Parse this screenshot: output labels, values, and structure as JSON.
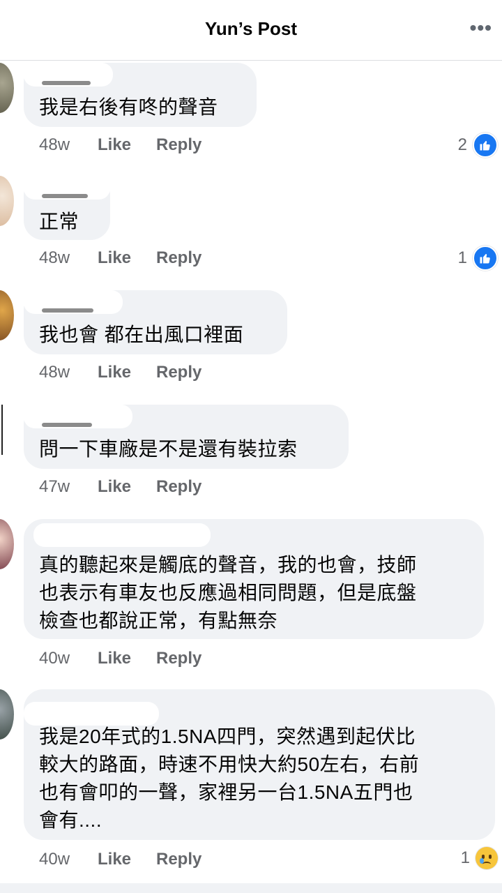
{
  "header": {
    "title": "Yun’s Post",
    "more_icon": "more-dots-icon"
  },
  "labels": {
    "like": "Like",
    "reply": "Reply"
  },
  "comments": [
    {
      "text": "我是右後有咚的聲音",
      "time": "48w",
      "reaction_count": "2",
      "reaction_type": "like"
    },
    {
      "text": "正常",
      "time": "48w",
      "reaction_count": "1",
      "reaction_type": "like"
    },
    {
      "text": "我也會 都在出風口裡面",
      "time": "48w",
      "reaction_count": "",
      "reaction_type": ""
    },
    {
      "text": "問一下車廠是不是還有裝拉索",
      "time": "47w",
      "reaction_count": "",
      "reaction_type": ""
    },
    {
      "text": "真的聽起來是觸底的聲音，我的也會，技師\n也表示有車友也反應過相同問題，但是底盤\n檢查也都說正常，有點無奈",
      "time": "40w",
      "reaction_count": "",
      "reaction_type": ""
    },
    {
      "text": "我是20年式的1.5NA四門，突然遇到起伏比\n較大的路面，時速不用快大約50左右，右前\n也有會叩的一聲，家裡另一台1.5NA五門也\n會有....",
      "time": "40w",
      "reaction_count": "1",
      "reaction_type": "sad"
    }
  ]
}
